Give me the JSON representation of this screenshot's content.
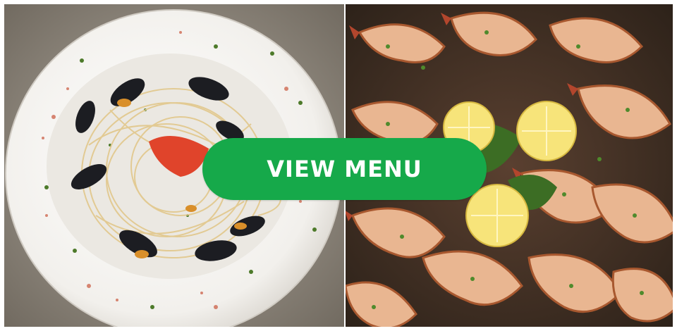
{
  "hero": {
    "cta_label": "VIEW MENU",
    "cta_color": "#16a94a",
    "images": [
      {
        "name": "pasta-with-mussels-photo"
      },
      {
        "name": "grilled-shrimp-with-lemon-photo"
      }
    ]
  }
}
